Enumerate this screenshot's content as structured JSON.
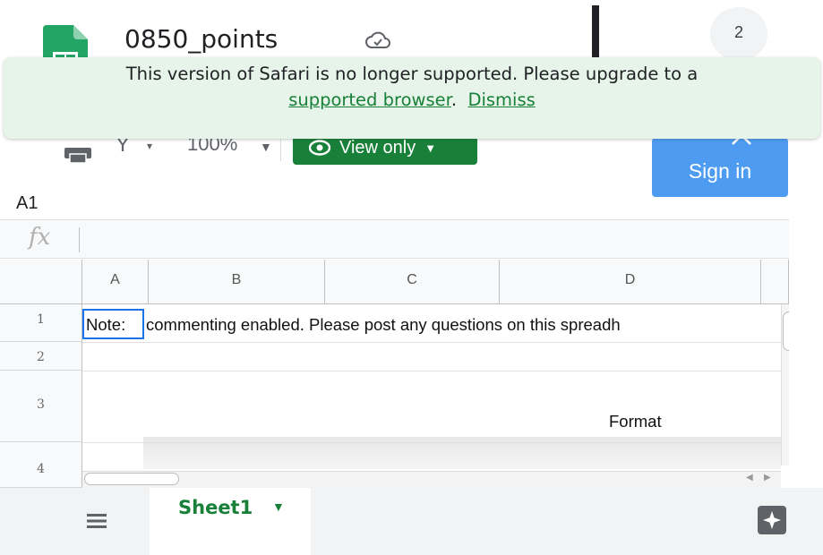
{
  "header": {
    "doc_title": "0850_points",
    "notification_count": "2"
  },
  "banner": {
    "message": "This version of Safari is no longer supported. Please upgrade to a",
    "link_label": "supported browser",
    "separator": ".",
    "dismiss_label": "Dismiss"
  },
  "toolbar": {
    "filter_symbol": "Y",
    "zoom": "100%",
    "view_only_label": "View only",
    "sign_in_label": "Sign in"
  },
  "name_box": "A1",
  "formula_bar": {
    "fx_label": "fx",
    "value": ""
  },
  "grid": {
    "columns": [
      "A",
      "B",
      "C",
      "D"
    ],
    "rows": [
      "1",
      "2",
      "3",
      "4"
    ],
    "cells": {
      "A1": "Note:",
      "B1": "commenting enabled.  Please post any questions on this spreadh",
      "D3": "Format"
    }
  },
  "sheet_tabs": [
    {
      "label": "Sheet1",
      "active": true
    }
  ],
  "icons": {
    "logo": "google-sheets-logo",
    "cloud": "cloud-check-icon",
    "print": "print-icon",
    "eye": "eye-icon",
    "all_sheets": "list-icon",
    "explore": "explore-icon"
  },
  "colors": {
    "brand_green": "#188038",
    "banner_bg": "#e6f4ea",
    "sign_in_blue": "#4e9cf2",
    "selection_blue": "#1a73e8"
  }
}
